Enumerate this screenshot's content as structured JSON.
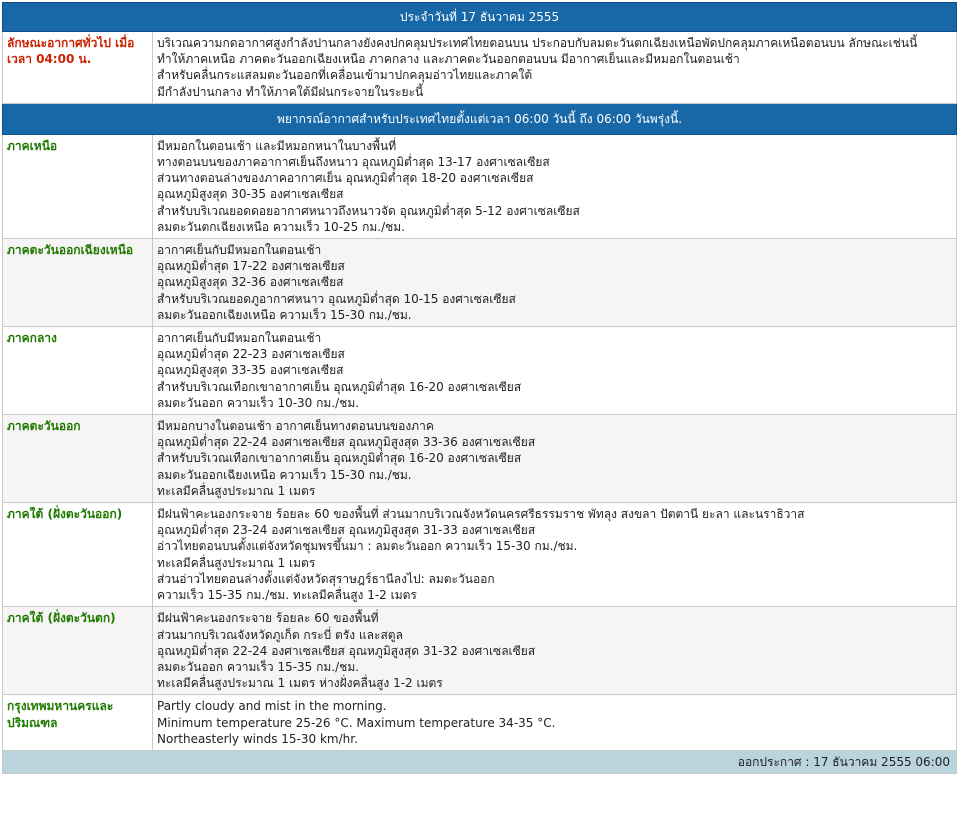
{
  "header": {
    "date_text": "ประจำวันที่ 17 ธันวาคม 2555"
  },
  "general": {
    "label": "ลักษณะอากาศทั่วไป เมื่อเวลา 04:00 น.",
    "lines": [
      "บริเวณความกดอากาศสูงกำลังปานกลางยังคงปกคลุมประเทศไทยตอนบน ประกอบกับลมตะวันตกเฉียงเหนือพัดปกคลุมภาคเหนือตอนบน ลักษณะเช่นนี้",
      "ทำให้ภาคเหนือ ภาคตะวันออกเฉียงเหนือ ภาคกลาง และภาคตะวันออกตอนบน มีอากาศเย็นและมีหมอกในตอนเช้า",
      "สำหรับคลื่นกระแสลมตะวันออกที่เคลื่อนเข้ามาปกคลุมอ่าวไทยและภาคใต้",
      "มีกำลังปานกลาง ทำให้ภาคใต้มีฝนกระจายในระยะนี้"
    ]
  },
  "forecast_bar": {
    "text": "พยากรณ์อากาศสำหรับประเทศไทยตั้งแต่เวลา 06:00 วันนี้ ถึง 06:00 วันพรุ่งนี้."
  },
  "regions": [
    {
      "name": "ภาคเหนือ",
      "lines": [
        "มีหมอกในตอนเช้า และมีหมอกหนาในบางพื้นที่",
        "ทางตอนบนของภาคอากาศเย็นถึงหนาว อุณหภูมิต่ำสุด 13-17 องศาเซลเซียส",
        "ส่วนทางตอนล่างของภาคอากาศเย็น อุณหภูมิต่ำสุด 18-20 องศาเซลเซียส",
        "อุณหภูมิสูงสุด 30-35 องศาเซลเซียส",
        "สำหรับบริเวณยอดดอยอากาศหนาวถึงหนาวจัด อุณหภูมิต่ำสุด 5-12 องศาเซลเซียส",
        "ลมตะวันตกเฉียงเหนือ ความเร็ว 10-25 กม./ชม."
      ]
    },
    {
      "name": "ภาคตะวันออกเฉียงเหนือ",
      "lines": [
        "อากาศเย็นกับมีหมอกในตอนเช้า",
        "อุณหภูมิต่ำสุด 17-22 องศาเซลเซียส",
        "อุณหภูมิสูงสุด 32-36 องศาเซลเซียส",
        "สำหรับบริเวณยอดภูอากาศหนาว อุณหภูมิต่ำสุด 10-15 องศาเซลเซียส",
        "ลมตะวันออกเฉียงเหนือ ความเร็ว 15-30 กม./ชม."
      ]
    },
    {
      "name": "ภาคกลาง",
      "lines": [
        "อากาศเย็นกับมีหมอกในตอนเช้า",
        "อุณหภูมิต่ำสุด 22-23 องศาเซลเซียส",
        "อุณหภูมิสูงสุด 33-35 องศาเซลเซียส",
        "สำหรับบริเวณเทือกเขาอากาศเย็น อุณหภูมิต่ำสุด 16-20 องศาเซลเซียส",
        "ลมตะวันออก ความเร็ว 10-30 กม./ชม."
      ]
    },
    {
      "name": "ภาคตะวันออก",
      "lines": [
        "มีหมอกบางในตอนเช้า อากาศเย็นทางตอนบนของภาค",
        "อุณหภูมิต่ำสุด 22-24 องศาเซลเซียส อุณหภูมิสูงสุด 33-36 องศาเซลเซียส",
        "สำหรับบริเวณเทือกเขาอากาศเย็น อุณหภูมิต่ำสุด 16-20 องศาเซลเซียส",
        "ลมตะวันออกเฉียงเหนือ ความเร็ว 15-30 กม./ชม.",
        "ทะเลมีคลื่นสูงประมาณ 1 เมตร"
      ]
    },
    {
      "name": "ภาคใต้ (ฝั่งตะวันออก)",
      "lines": [
        "มีฝนฟ้าคะนองกระจาย ร้อยละ 60 ของพื้นที่ ส่วนมากบริเวณจังหวัดนครศรีธรรมราช พัทลุง สงขลา ปัตตานี ยะลา และนราธิวาส",
        "อุณหภูมิต่ำสุด 23-24 องศาเซลเซียส อุณหภูมิสูงสุด 31-33 องศาเซลเซียส",
        "อ่าวไทยตอนบนตั้งแต่จังหวัดชุมพรขึ้นมา : ลมตะวันออก ความเร็ว 15-30 กม./ชม.",
        "ทะเลมีคลื่นสูงประมาณ 1 เมตร",
        "ส่วนอ่าวไทยตอนล่างตั้งแต่จังหวัดสุราษฎร์ธานีลงไป: ลมตะวันออก",
        "ความเร็ว 15-35 กม./ชม. ทะเลมีคลื่นสูง 1-2 เมตร"
      ]
    },
    {
      "name": "ภาคใต้ (ฝั่งตะวันตก)",
      "lines": [
        "มีฝนฟ้าคะนองกระจาย ร้อยละ 60 ของพื้นที่",
        "ส่วนมากบริเวณจังหวัดภูเก็ต กระบี่ ตรัง และสตูล",
        "อุณหภูมิต่ำสุด 22-24 องศาเซลเซียส อุณหภูมิสูงสุด 31-32 องศาเซลเซียส",
        "ลมตะวันออก ความเร็ว 15-35 กม./ชม.",
        "ทะเลมีคลื่นสูงประมาณ 1 เมตร ห่างฝั่งคลื่นสูง 1-2 เมตร"
      ]
    },
    {
      "name": "กรุงเทพมหานครและปริมณฑล",
      "lines": [
        "Partly cloudy and mist in the morning.",
        "Minimum temperature 25-26 °C. Maximum temperature 34-35 °C.",
        "Northeasterly winds 15-30 km/hr."
      ]
    }
  ],
  "footer": {
    "issued_text": "ออกประกาศ : 17 ธันวาคม 2555 06:00"
  },
  "colors": {
    "bar_blue": "#1868a8",
    "label_green": "#1f7a00",
    "label_red": "#cc2200",
    "footer_bg": "#b9d4dc"
  }
}
